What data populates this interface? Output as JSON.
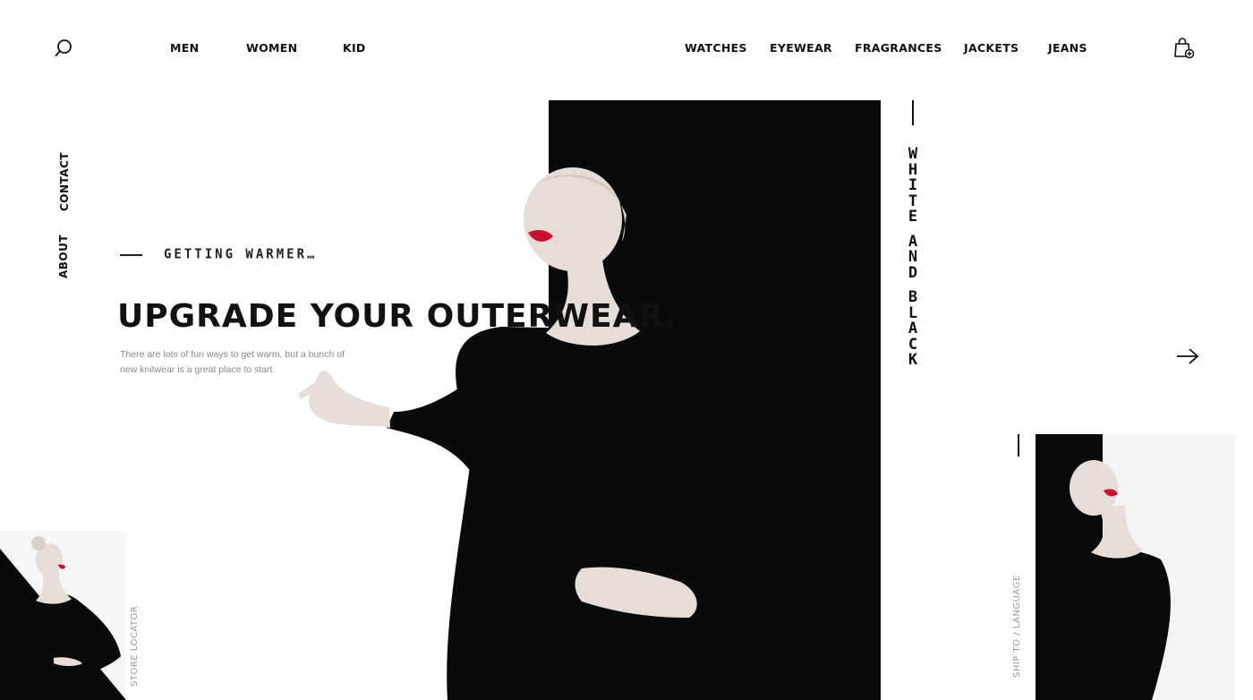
{
  "nav": {
    "left": [
      "MEN",
      "WOMEN",
      "KID"
    ],
    "right": [
      "WATCHES",
      "EYEWEAR",
      "FRAGRANCES",
      "JACKETS",
      "JEANS"
    ]
  },
  "icons": {
    "search": "search-icon",
    "cart": "shopping-bag-add-icon",
    "arrow": "arrow-right-icon"
  },
  "side": {
    "contact": "CONTACT",
    "about": "ABOUT"
  },
  "hero": {
    "eyebrow": "GETTING WARMER…",
    "headline": "UPGRADE YOUR OUTERWEAR.",
    "description": "There are lots of fun ways to get warm, but a bunch of new knitwear is a great place to start.",
    "vertical_title_words": [
      "WHITE",
      "AND",
      "BLACK"
    ]
  },
  "footer_side": {
    "store_locator": "STORE LOCATOR",
    "ship_to": "SHIP TO / LANGUAGE"
  },
  "colors": {
    "lips": "#c8102e",
    "panel": "#0a0a0a",
    "skin": "#e8dcd6"
  }
}
